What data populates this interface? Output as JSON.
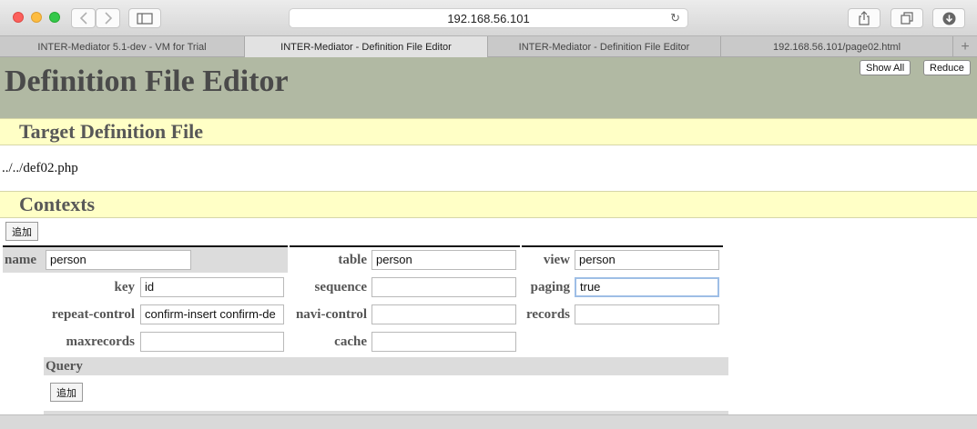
{
  "browser": {
    "url": "192.168.56.101",
    "tabs": [
      {
        "label": "INTER-Mediator 5.1-dev - VM for Trial",
        "active": false
      },
      {
        "label": "INTER-Mediator - Definition File Editor",
        "active": true
      },
      {
        "label": "INTER-Mediator - Definition File Editor",
        "active": false
      },
      {
        "label": "192.168.56.101/page02.html",
        "active": false
      }
    ],
    "new_tab": "+"
  },
  "header": {
    "title": "Definition File Editor",
    "show_all": "Show All",
    "reduce": "Reduce"
  },
  "target": {
    "section_title": "Target Definition File",
    "path": "../../def02.php"
  },
  "contexts": {
    "section_title": "Contexts",
    "add_label": "追加",
    "name_label": "name",
    "name_value": "person",
    "table_label": "table",
    "table_value": "person",
    "view_label": "view",
    "view_value": "person",
    "key_label": "key",
    "key_value": "id",
    "sequence_label": "sequence",
    "sequence_value": "",
    "paging_label": "paging",
    "paging_value": "true",
    "repeat_control_label": "repeat-control",
    "repeat_control_value": "confirm-insert confirm-de",
    "navi_control_label": "navi-control",
    "navi_control_value": "",
    "records_label": "records",
    "records_value": "",
    "maxrecords_label": "maxrecords",
    "maxrecords_value": "",
    "cache_label": "cache",
    "cache_value": "",
    "query_label": "Query",
    "query_add_label": "追加"
  }
}
